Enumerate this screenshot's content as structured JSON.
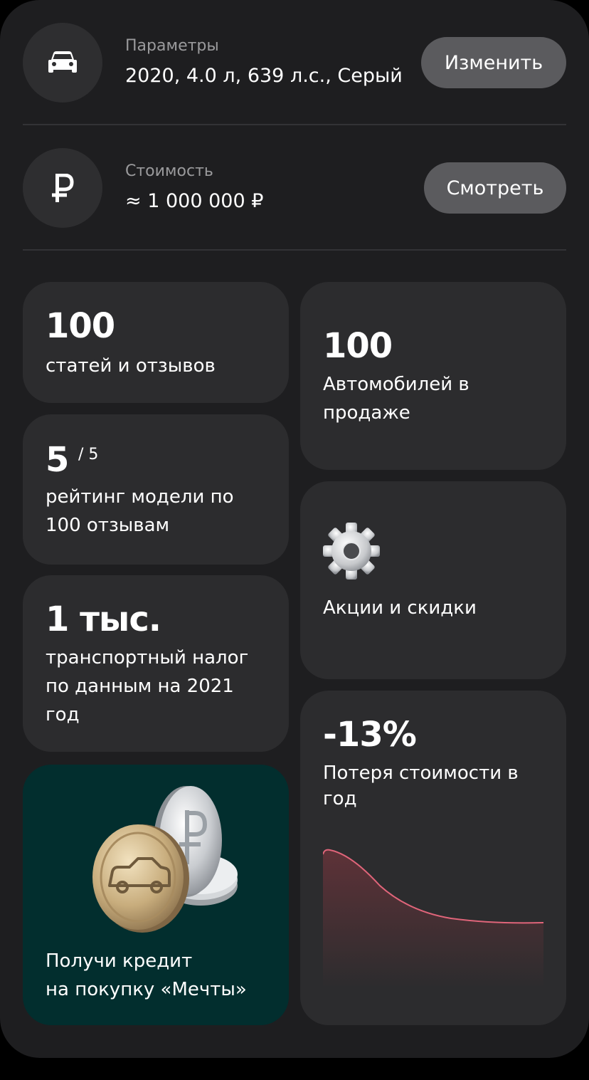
{
  "params": {
    "label": "Параметры",
    "value": "2020, 4.0 л, 639 л.с., Серый",
    "button": "Изменить",
    "icon": "car-icon"
  },
  "price": {
    "label": "Стоимость",
    "value": "≈ 1 000 000 ₽",
    "button": "Смотреть",
    "icon": "ruble-icon"
  },
  "articles": {
    "count": "100",
    "label": "статей и отзывов"
  },
  "for_sale": {
    "count": "100",
    "label_line1": "Автомобилей в",
    "label_line2": "продаже"
  },
  "rating": {
    "value": "5",
    "max": "/ 5",
    "label_line1": "рейтинг модели по",
    "label_line2": "100 отзывам"
  },
  "promo": {
    "label": "Акции и скидки",
    "icon": "gear-icon"
  },
  "tax": {
    "value": "1 тыс.",
    "line1": "транспортный налог",
    "line2": "по данным на 2021",
    "line3": "год"
  },
  "depreciation": {
    "value": "-13%",
    "line1": "Потеря стоимости в",
    "line2": "год",
    "line_color": "#e0657a"
  },
  "credit": {
    "line1": "Получи кредит",
    "line2": "на покупку «Мечты»",
    "bg": "#022e2e"
  }
}
